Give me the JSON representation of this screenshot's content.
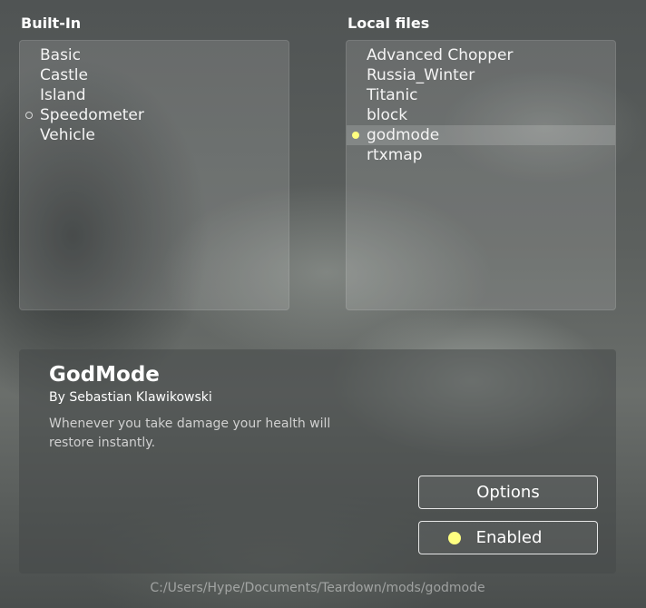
{
  "builtin": {
    "title": "Built-In",
    "items": [
      {
        "label": "Basic",
        "marker": ""
      },
      {
        "label": "Castle",
        "marker": ""
      },
      {
        "label": "Island",
        "marker": ""
      },
      {
        "label": "Speedometer",
        "marker": "outline"
      },
      {
        "label": "Vehicle",
        "marker": ""
      }
    ]
  },
  "local": {
    "title": "Local files",
    "items": [
      {
        "label": "Advanced Chopper",
        "marker": ""
      },
      {
        "label": "Russia_Winter",
        "marker": ""
      },
      {
        "label": "Titanic",
        "marker": ""
      },
      {
        "label": "block",
        "marker": ""
      },
      {
        "label": "godmode",
        "marker": "filled",
        "selected": true
      },
      {
        "label": "rtxmap",
        "marker": ""
      }
    ]
  },
  "details": {
    "title": "GodMode",
    "author": "By Sebastian Klawikowski",
    "description": "Whenever you take damage your health will restore instantly.",
    "options_label": "Options",
    "enabled_label": "Enabled"
  },
  "path": "C:/Users/Hype/Documents/Teardown/mods/godmode",
  "colors": {
    "enabled_dot": "#ffff80",
    "selected_row": "rgba(255,255,255,0.16)"
  }
}
